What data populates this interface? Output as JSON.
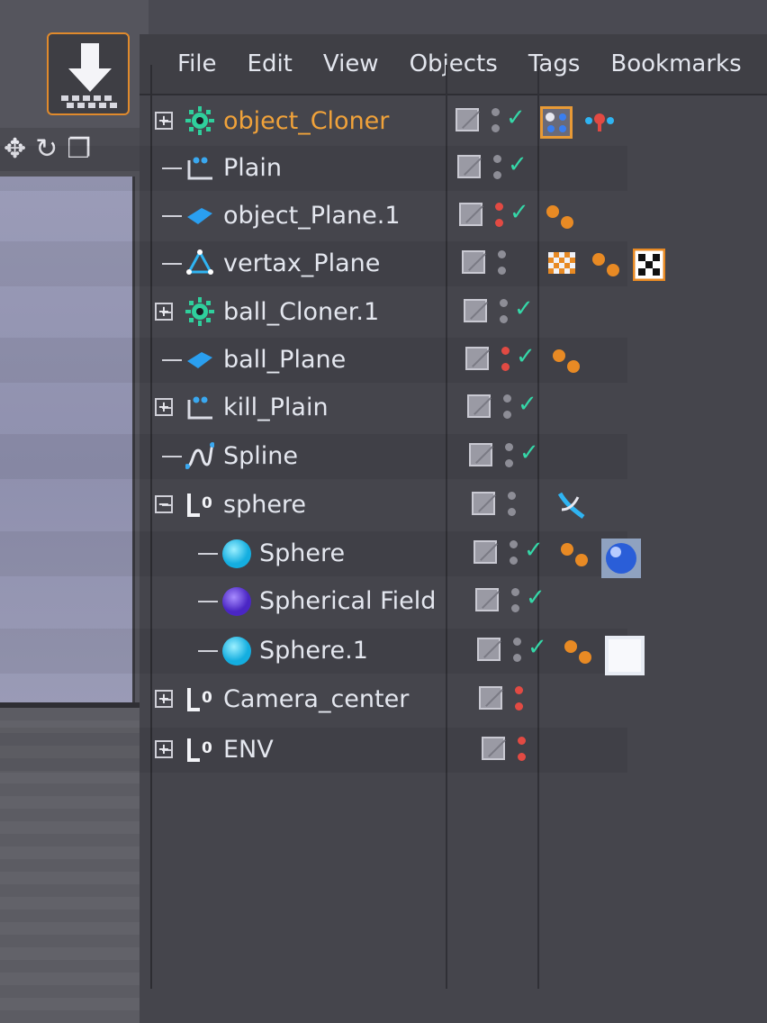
{
  "menu": {
    "items": [
      "File",
      "Edit",
      "View",
      "Objects",
      "Tags",
      "Bookmarks"
    ]
  },
  "objects": [
    {
      "name": "object_Cloner",
      "active": true
    },
    {
      "name": "Plain"
    },
    {
      "name": "object_Plane.1"
    },
    {
      "name": "vertax_Plane"
    },
    {
      "name": "ball_Cloner.1"
    },
    {
      "name": "ball_Plane"
    },
    {
      "name": "kill_Plain"
    },
    {
      "name": "Spline"
    },
    {
      "name": "sphere"
    },
    {
      "name": "Sphere"
    },
    {
      "name": "Spherical Field"
    },
    {
      "name": "Sphere.1"
    },
    {
      "name": "Camera_center"
    },
    {
      "name": "ENV"
    }
  ],
  "icons": {
    "cloner": "cloner-icon",
    "plain": "plain-icon",
    "plane": "plane-icon",
    "polygon": "polygon-icon",
    "spline": "spline-icon",
    "null": "null-icon",
    "sphere": "sphere-icon",
    "field": "spherical-field-icon",
    "expand": "expand-icon",
    "collapse": "collapse-icon"
  },
  "colors": {
    "active_text": "#f0a23a",
    "check": "#35d7a8",
    "red_dot": "#e24a43",
    "tag_orange": "#e88a24",
    "sphere_cyan": "#2ec9ee",
    "field_purple": "#6a44d8",
    "panel_bg": "#45454c"
  }
}
